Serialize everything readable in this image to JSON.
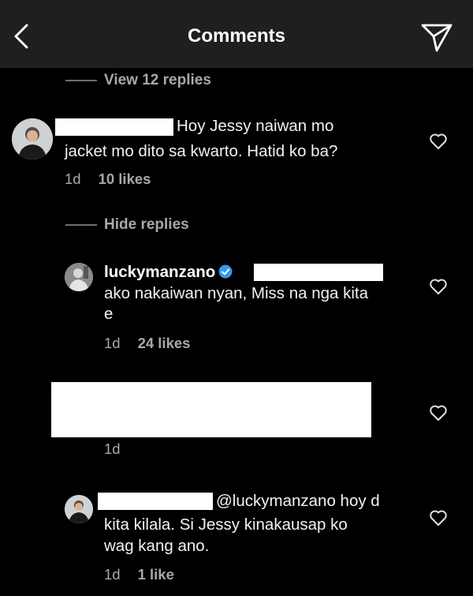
{
  "header": {
    "title": "Comments"
  },
  "view_replies": {
    "label": "View 12 replies"
  },
  "comment1": {
    "text_line1": "Hoy Jessy naiwan mo",
    "text_line2": "jacket mo dito sa kwarto. Hatid ko ba?",
    "time": "1d",
    "likes": "10 likes"
  },
  "hide_replies": {
    "label": "Hide replies"
  },
  "reply1": {
    "username": "luckymanzano",
    "text_line1": "ako nakaiwan nyan, Miss na nga kita",
    "text_line2": "e",
    "time": "1d",
    "likes": "24 likes"
  },
  "reply2": {
    "time": "1d"
  },
  "reply3": {
    "text_line1": "@luckymanzano hoy d",
    "text_line2": "kita kilala. Si Jessy kinakausap ko",
    "text_line3": "wag kang ano.",
    "time": "1d",
    "likes": "1 like"
  },
  "colors": {
    "background": "#000000",
    "header": "#1f1f1f",
    "text": "#f5f5f5",
    "muted": "#a8a8a8",
    "verified": "#3897f0"
  }
}
